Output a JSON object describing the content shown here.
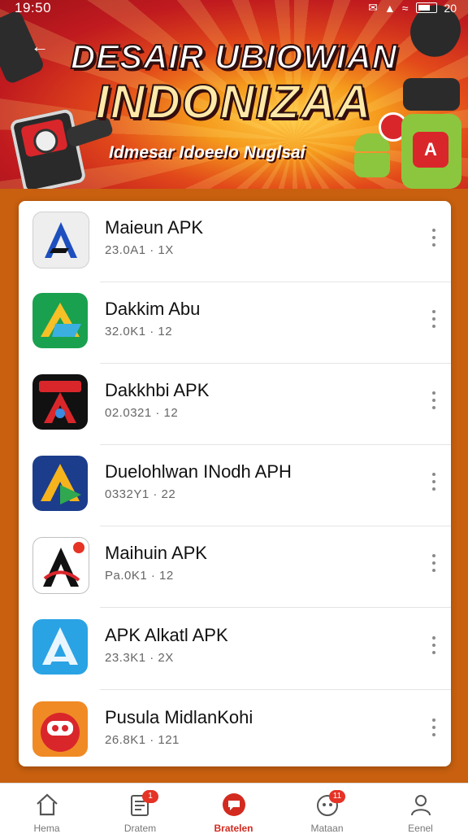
{
  "status_bar": {
    "time": "19:50",
    "battery": "20"
  },
  "banner": {
    "title_line1": "DESAIR UBIOWIAN",
    "title_line2": "INDONIZAA",
    "subtitle": "Idmesar Idoeelo Nuglsai",
    "colors": {
      "primary": "#c01a1f",
      "accent": "#f59a1c"
    }
  },
  "apps": [
    {
      "name": "Maieun APK",
      "meta": "23.0A1 · 1X",
      "icon": "a-triangle-icon"
    },
    {
      "name": "Dakkim Abu",
      "meta": "32.0K1 · 12",
      "icon": "drive-arrow-icon"
    },
    {
      "name": "Dakkhbi APK",
      "meta": "02.0321 · 12",
      "icon": "red-a-icon"
    },
    {
      "name": "Duelohlwan INodh APH",
      "meta": "0332Y1 · 22",
      "icon": "navy-arrow-icon"
    },
    {
      "name": "Maihuin APK",
      "meta": "Pa.0K1 · 12",
      "icon": "black-a-icon"
    },
    {
      "name": "APK Alkatl APK",
      "meta": "23.3K1 · 2X",
      "icon": "blue-a-icon"
    },
    {
      "name": "Pusula MidlanKohi",
      "meta": "26.8K1 · 121",
      "icon": "red-mascot-icon"
    }
  ],
  "nav": {
    "tabs": [
      {
        "label": "Hema",
        "icon": "home-icon",
        "badge": ""
      },
      {
        "label": "Dratem",
        "icon": "document-icon",
        "badge": "1"
      },
      {
        "label": "Bratelen",
        "icon": "chat-icon",
        "badge": ""
      },
      {
        "label": "Mataan",
        "icon": "bell-icon",
        "badge": "11"
      },
      {
        "label": "Eenel",
        "icon": "profile-icon",
        "badge": ""
      }
    ],
    "active_index": 2,
    "active_color": "#d32a1f"
  }
}
